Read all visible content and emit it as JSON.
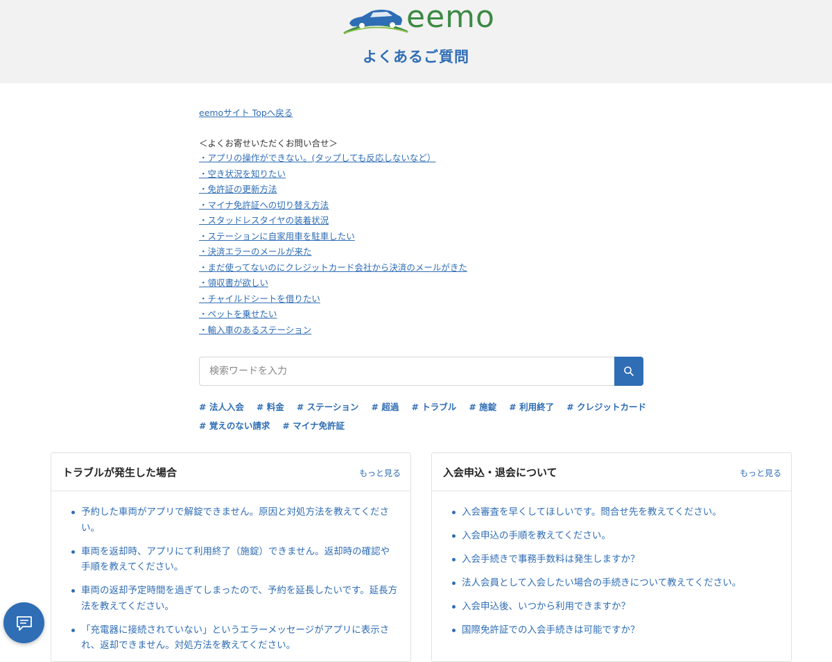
{
  "header": {
    "logo_text": "eemo",
    "title": "よくあるご質問"
  },
  "top_link": "eemoサイト Topへ戻る",
  "faq": {
    "heading": "＜よくお寄せいただくお問い合せ＞",
    "items": [
      "・アプリの操作ができない。(タップしても反応しないなど）",
      "・空き状況を知りたい",
      "・免許証の更新方法",
      "・マイナ免許証への切り替え方法",
      "・スタッドレスタイヤの装着状況",
      "・ステーションに自家用車を駐車したい",
      "・決済エラーのメールが来た",
      "・まだ使ってないのにクレジットカード会社から決済のメールがきた",
      "・領収書が欲しい",
      "・チャイルドシートを借りたい",
      "・ペットを乗せたい",
      "・輸入車のあるステーション"
    ]
  },
  "search": {
    "placeholder": "検索ワードを入力",
    "icon": "search-icon"
  },
  "tags": {
    "row1": [
      "# 法人入会",
      "# 料金",
      "# ステーション",
      "# 超過",
      "# トラブル",
      "# 施錠",
      "# 利用終了",
      "# クレジットカード"
    ],
    "row2": [
      "# 覚えのない請求",
      "# マイナ免許証"
    ]
  },
  "cards": {
    "left": {
      "title": "トラブルが発生した場合",
      "more": "もっと見る",
      "items": [
        "予約した車両がアプリで解錠できません。原因と対処方法を教えてください。",
        "車両を返却時、アプリにて利用終了（施錠）できません。返却時の確認や手順を教えてください。",
        "車両の返却予定時間を過ぎてしまったので、予約を延長したいです。延長方法を教えてください。",
        "「充電器に接続されていない」というエラーメッセージがアプリに表示され、返却できません。対処方法を教えてください。"
      ]
    },
    "right": {
      "title": "入会申込・退会について",
      "more": "もっと見る",
      "items": [
        "入会審査を早くしてほしいです。問合せ先を教えてください。",
        "入会申込の手順を教えてください。",
        "入会手続きで事務手数料は発生しますか？",
        "法人会員として入会したい場合の手続きについて教えてください。",
        "入会申込後、いつから利用できますか？",
        "国際免許証での入会手続きは可能ですか？"
      ]
    }
  },
  "chat": {
    "icon": "chat-bubble-icon"
  },
  "colors": {
    "accent": "#2f6db5",
    "logo_green": "#3b8a44",
    "header_bg": "#f2f2f2"
  }
}
